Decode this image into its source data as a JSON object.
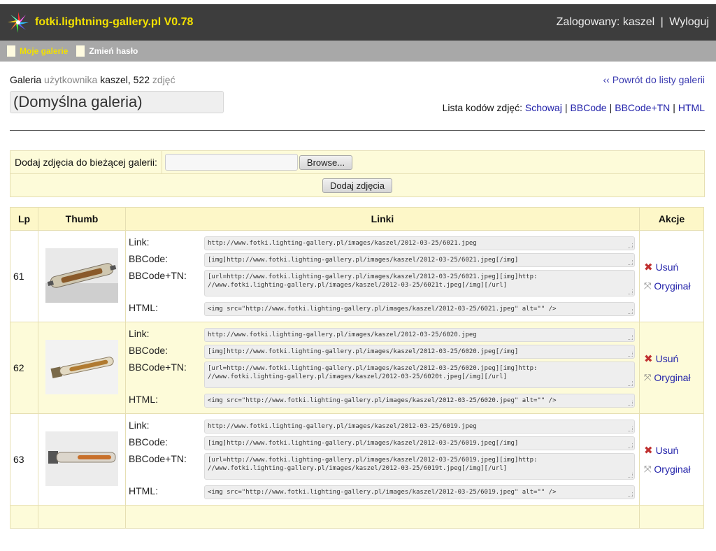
{
  "app": {
    "title": "fotki.lightning-gallery.pl V0.78",
    "logged_in_label": "Zalogowany:",
    "username": "kaszel",
    "logout": "Wyloguj"
  },
  "nav": {
    "items": [
      {
        "label": "Moje galerie",
        "active": true
      },
      {
        "label": "Zmień hasło",
        "active": false
      }
    ]
  },
  "gallery": {
    "label_gallery": "Galeria",
    "label_user": "użytkownika",
    "user": "kaszel",
    "count": "522",
    "label_photos": "zdjęć",
    "name": "(Domyślna galeria)",
    "back_link": "‹‹ Powrót do listy galerii",
    "codes_label": "Lista kodów zdjęć:",
    "codes": [
      "Schowaj",
      "BBCode",
      "BBCode+TN",
      "HTML"
    ]
  },
  "upload": {
    "label": "Dodaj zdjęcia do bieżącej galerii:",
    "browse": "Browse...",
    "submit": "Dodaj zdjęcia"
  },
  "table": {
    "headers": {
      "lp": "Lp",
      "thumb": "Thumb",
      "links": "Linki",
      "actions": "Akcje"
    },
    "link_labels": {
      "link": "Link:",
      "bbcode": "BBCode:",
      "bbcode_tn": "BBCode+TN:",
      "html": "HTML:"
    },
    "action_labels": {
      "delete": "Usuń",
      "original": "Oryginał"
    },
    "rows": [
      {
        "lp": "61",
        "link": "http://www.fotki.lighting-gallery.pl/images/kaszel/2012-03-25/6021.jpeg",
        "bbcode": "[img]http://www.fotki.lighting-gallery.pl/images/kaszel/2012-03-25/6021.jpeg[/img]",
        "bbcode_tn": "[url=http://www.fotki.lighting-gallery.pl/images/kaszel/2012-03-25/6021.jpeg][img]http:\n//www.fotki.lighting-gallery.pl/images/kaszel/2012-03-25/6021t.jpeg[/img][/url]",
        "html": "<img src=\"http://www.fotki.lighting-gallery.pl/images/kaszel/2012-03-25/6021.jpeg\" alt=\"\" />"
      },
      {
        "lp": "62",
        "link": "http://www.fotki.lighting-gallery.pl/images/kaszel/2012-03-25/6020.jpeg",
        "bbcode": "[img]http://www.fotki.lighting-gallery.pl/images/kaszel/2012-03-25/6020.jpeg[/img]",
        "bbcode_tn": "[url=http://www.fotki.lighting-gallery.pl/images/kaszel/2012-03-25/6020.jpeg][img]http:\n//www.fotki.lighting-gallery.pl/images/kaszel/2012-03-25/6020t.jpeg[/img][/url]",
        "html": "<img src=\"http://www.fotki.lighting-gallery.pl/images/kaszel/2012-03-25/6020.jpeg\" alt=\"\" />"
      },
      {
        "lp": "63",
        "link": "http://www.fotki.lighting-gallery.pl/images/kaszel/2012-03-25/6019.jpeg",
        "bbcode": "[img]http://www.fotki.lighting-gallery.pl/images/kaszel/2012-03-25/6019.jpeg[/img]",
        "bbcode_tn": "[url=http://www.fotki.lighting-gallery.pl/images/kaszel/2012-03-25/6019.jpeg][img]http:\n//www.fotki.lighting-gallery.pl/images/kaszel/2012-03-25/6019t.jpeg[/img][/url]",
        "html": "<img src=\"http://www.fotki.lighting-gallery.pl/images/kaszel/2012-03-25/6019.jpeg\" alt=\"\" />"
      }
    ]
  },
  "colors": {
    "topbar": "#3d3d3d",
    "brand": "#f3e100",
    "subnav": "#a8a8a8",
    "row_highlight": "#fdfbd9",
    "link": "#2222aa",
    "delete": "#c03030"
  }
}
